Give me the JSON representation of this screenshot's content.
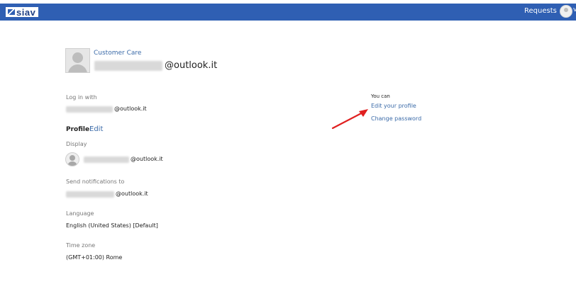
{
  "header": {
    "logo_text": "siav",
    "requests_label": "Requests",
    "extra": "v"
  },
  "user": {
    "organization": "Customer Care",
    "email_domain": "@outlook.it"
  },
  "login": {
    "label": "Log in with",
    "value": "@outlook.it"
  },
  "profile": {
    "heading": "Profile",
    "edit_label": "Edit",
    "display_label": "Display",
    "display_value": "@outlook.it",
    "notifications_label": "Send notifications to",
    "notifications_value": "@outlook.it",
    "language_label": "Language",
    "language_value": "English (United States) [Default]",
    "timezone_label": "Time zone",
    "timezone_value": "(GMT+01:00) Rome"
  },
  "actions": {
    "heading": "You can",
    "edit_profile": "Edit your profile",
    "change_password": "Change password"
  },
  "colors": {
    "topbar": "#2f5fb3",
    "link": "#3a6aa8",
    "arrow": "#e02020"
  }
}
